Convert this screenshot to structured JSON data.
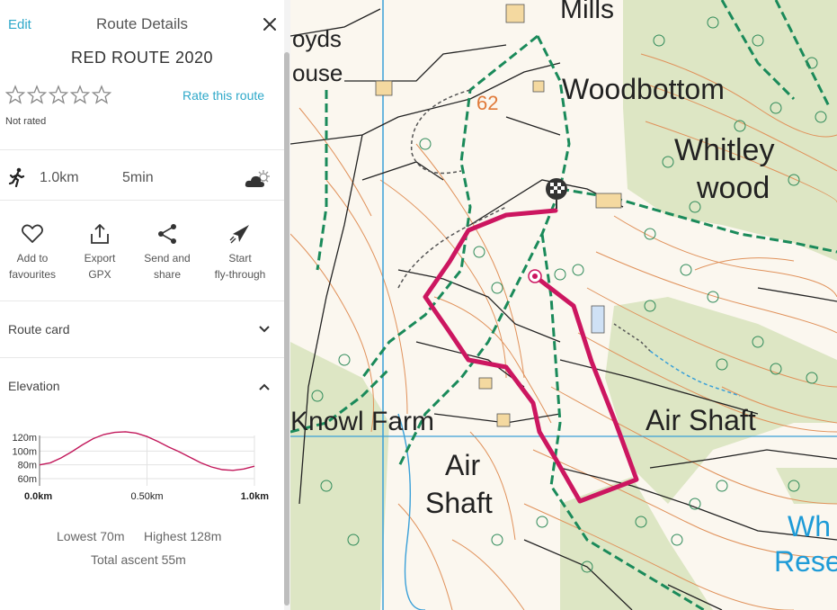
{
  "header": {
    "edit_label": "Edit",
    "title": "Route Details",
    "close_icon": "close-icon"
  },
  "route": {
    "name": "RED ROUTE 2020",
    "rating_label": "Not rated",
    "rating_value": 0,
    "rating_max": 5,
    "rate_link": "Rate this route",
    "distance": "1.0km",
    "duration": "5min",
    "activity_icon": "walking-icon",
    "weather_icon": "weather-partly-cloudy-icon"
  },
  "actions": [
    {
      "icon": "heart-icon",
      "line1": "Add to",
      "line2": "favourites"
    },
    {
      "icon": "export-icon",
      "line1": "Export",
      "line2": "GPX"
    },
    {
      "icon": "share-icon",
      "line1": "Send and",
      "line2": "share"
    },
    {
      "icon": "paper-plane-icon",
      "line1": "Start",
      "line2": "fly-through"
    }
  ],
  "sections": {
    "route_card": {
      "label": "Route card",
      "expanded": false
    },
    "elevation": {
      "label": "Elevation",
      "expanded": true
    }
  },
  "chart_data": {
    "type": "line",
    "x_ticks": [
      "0.0km",
      "0.50km",
      "1.0km"
    ],
    "y_ticks": [
      "120m",
      "100m",
      "80m",
      "60m"
    ],
    "ylim": [
      60,
      130
    ],
    "xlim": [
      0,
      1.0
    ],
    "color": "#c2185b",
    "series": [
      {
        "x": [
          0.0,
          0.05,
          0.1,
          0.15,
          0.2,
          0.25,
          0.3,
          0.35,
          0.4,
          0.45,
          0.5,
          0.55,
          0.6,
          0.65,
          0.7,
          0.75,
          0.8,
          0.85,
          0.9,
          0.95,
          1.0
        ],
        "y": [
          80,
          83,
          90,
          99,
          109,
          118,
          124,
          127,
          128,
          126,
          121,
          114,
          106,
          99,
          91,
          83,
          77,
          73,
          72,
          74,
          78
        ]
      }
    ]
  },
  "elevation_stats": {
    "lowest": "Lowest 70m",
    "highest": "Highest 128m",
    "ascent": "Total ascent 55m"
  },
  "map": {
    "labels": [
      "Mills",
      "oyds",
      "ouse",
      "62",
      "Woodbottom",
      "Whitley",
      "wood",
      "Knowl Farm",
      "Air Shaft",
      "Air",
      "Shaft",
      "Wh",
      "Rese"
    ],
    "route_color": "#cc1660"
  }
}
